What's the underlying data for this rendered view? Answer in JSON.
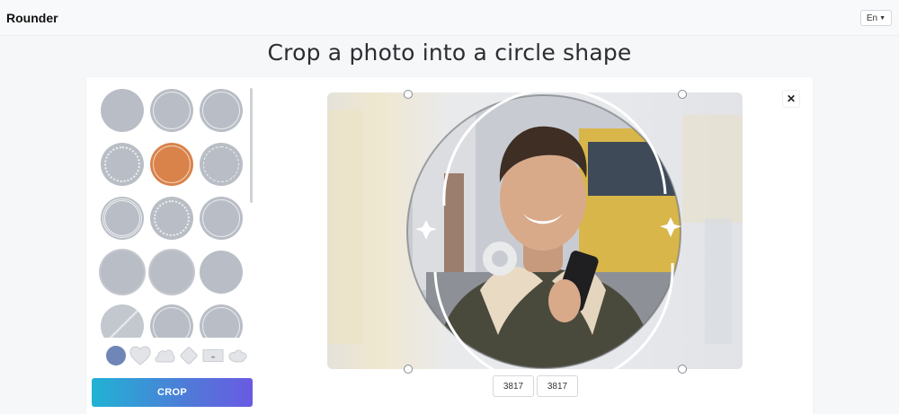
{
  "app": {
    "brand": "Rounder",
    "language": "En"
  },
  "page": {
    "headline": "Crop a photo into a circle shape"
  },
  "frames": [
    {
      "style": "plain"
    },
    {
      "style": "ring"
    },
    {
      "style": "ring"
    },
    {
      "style": "dotted"
    },
    {
      "style": "ring",
      "selected": true
    },
    {
      "style": "dashed"
    },
    {
      "style": "double"
    },
    {
      "style": "dotted"
    },
    {
      "style": "ring"
    },
    {
      "style": "scallop"
    },
    {
      "style": "scallop"
    },
    {
      "style": "plain"
    },
    {
      "style": "lined"
    },
    {
      "style": "ring"
    },
    {
      "style": "ring"
    }
  ],
  "shapes": [
    "circle-shape-icon",
    "heart-shape-icon",
    "cloud-shape-icon",
    "diamond-shape-icon",
    "rectangle-shape-icon",
    "blob-shape-icon"
  ],
  "actions": {
    "crop_label": "CROP"
  },
  "dimensions": {
    "width": "3817",
    "height": "3817"
  },
  "colors": {
    "accent_start": "#20b3d4",
    "accent_end": "#6a5ae3",
    "selected_frame": "#d9824a",
    "shape_active": "#6f86b6"
  }
}
